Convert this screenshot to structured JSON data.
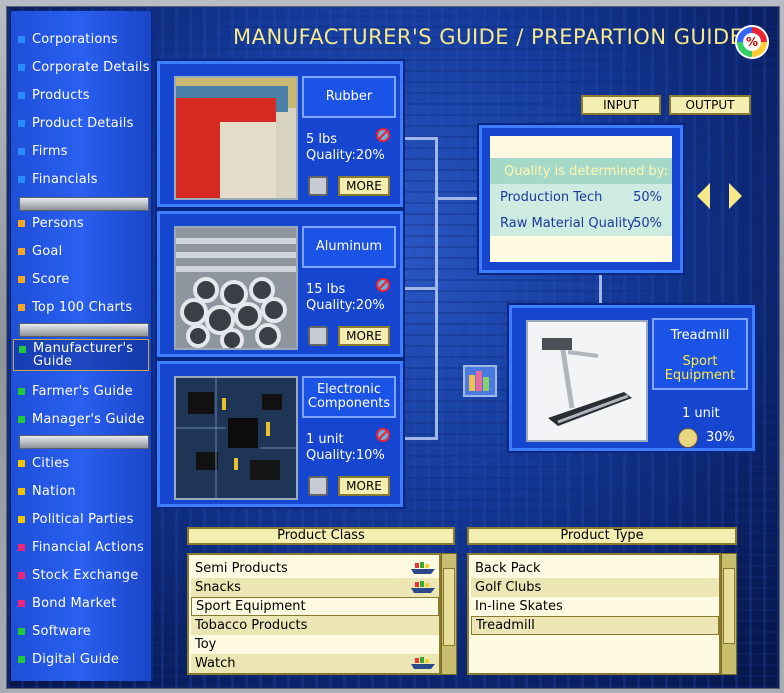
{
  "title": "MANUFACTURER'S GUIDE / PREPARTION GUIDE",
  "header": {
    "input_label": "INPUT",
    "output_label": "OUTPUT"
  },
  "sidebar": {
    "items": [
      {
        "label": "Corporations",
        "color": "#2a8cff"
      },
      {
        "label": "Corporate Details",
        "color": "#2a8cff"
      },
      {
        "label": "Products",
        "color": "#2a8cff"
      },
      {
        "label": "Product Details",
        "color": "#2a8cff"
      },
      {
        "label": "Firms",
        "color": "#2a8cff"
      },
      {
        "label": "Financials",
        "color": "#2a8cff"
      },
      {
        "label": "Persons",
        "color": "#f5a623"
      },
      {
        "label": "Goal",
        "color": "#f5a623"
      },
      {
        "label": "Score",
        "color": "#f5a623"
      },
      {
        "label": "Top 100 Charts",
        "color": "#f5a623"
      },
      {
        "label": "Manufacturer's Guide",
        "color": "#22c83a"
      },
      {
        "label": "Farmer's Guide",
        "color": "#22c83a"
      },
      {
        "label": "Manager's Guide",
        "color": "#22c83a"
      },
      {
        "label": "Cities",
        "color": "#f5c400"
      },
      {
        "label": "Nation",
        "color": "#f5c400"
      },
      {
        "label": "Political Parties",
        "color": "#f5c400"
      },
      {
        "label": "Financial Actions",
        "color": "#e8267a"
      },
      {
        "label": "Stock Exchange",
        "color": "#e8267a"
      },
      {
        "label": "Bond Market",
        "color": "#e8267a"
      },
      {
        "label": "Software",
        "color": "#22c83a"
      },
      {
        "label": "Digital Guide",
        "color": "#22c83a"
      }
    ]
  },
  "materials": [
    {
      "name": "Rubber",
      "quantity": "5 lbs",
      "quality": "Quality:20%",
      "more": "MORE"
    },
    {
      "name": "Aluminum",
      "quantity": "15 lbs",
      "quality": "Quality:20%",
      "more": "MORE"
    },
    {
      "name": "Electronic Components",
      "quantity": "1 unit",
      "quality": "Quality:10%",
      "more": "MORE"
    }
  ],
  "quality_box": {
    "heading": "Quality is determined by:",
    "rows": [
      {
        "label": "Production Tech",
        "value": "50%"
      },
      {
        "label": "Raw Material Quality",
        "value": "50%"
      }
    ]
  },
  "product": {
    "name": "Treadmill",
    "category": "Sport Equipment",
    "quantity": "1 unit",
    "quality": "30%"
  },
  "product_class": {
    "header": "Product Class",
    "items": [
      "Semi Products",
      "Snacks",
      "Sport Equipment",
      "Tobacco Products",
      "Toy",
      "Watch"
    ],
    "selected": "Sport Equipment"
  },
  "product_type": {
    "header": "Product Type",
    "items": [
      "Back Pack",
      "Golf Clubs",
      "In-line Skates",
      "Treadmill"
    ],
    "selected": "Treadmill"
  }
}
